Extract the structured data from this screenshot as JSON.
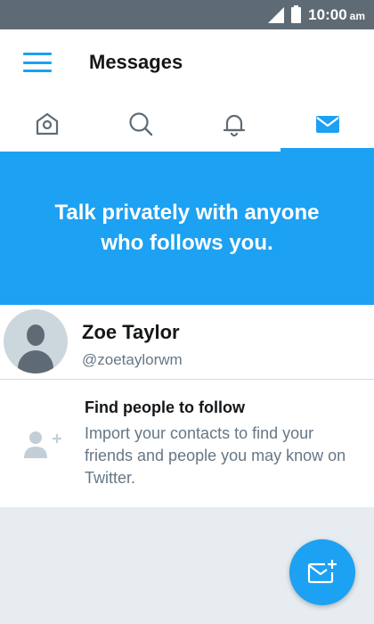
{
  "status_bar": {
    "time": "10:00",
    "ampm": "am"
  },
  "header": {
    "title": "Messages"
  },
  "tabs": [
    {
      "name": "home",
      "icon": "home-icon",
      "active": false
    },
    {
      "name": "search",
      "icon": "search-icon",
      "active": false
    },
    {
      "name": "notifications",
      "icon": "bell-icon",
      "active": false
    },
    {
      "name": "messages",
      "icon": "envelope-icon",
      "active": true
    }
  ],
  "banner": {
    "text": "Talk privately with anyone who follows you."
  },
  "profile": {
    "name": "Zoe Taylor",
    "handle": "@zoetaylorwm"
  },
  "find_people": {
    "title": "Find people to follow",
    "description": "Import your contacts to find your friends and people you may know on Twitter."
  },
  "colors": {
    "accent": "#1da1f2",
    "status_bar": "#5f6b74",
    "muted_text": "#657786",
    "background": "#e6ecf0"
  }
}
